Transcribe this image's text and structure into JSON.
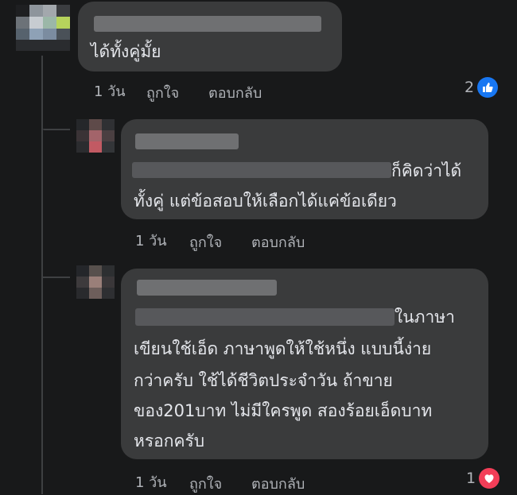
{
  "comments": [
    {
      "author": "",
      "text_lines": [
        "ได้ทั้งคู่มั้ย"
      ],
      "time": "1 วัน",
      "like_label": "ถูกใจ",
      "reply_label": "ตอบกลับ",
      "reaction_count": "2",
      "reaction": "like-icon",
      "reaction_color": "#1877f2"
    },
    {
      "author": "",
      "text_lines": [
        "ก็คิดว่าได้",
        "ทั้งคู่ แต่ข้อสอบให้เลือกได้แค่ข้อเดียว"
      ],
      "time": "1 วัน",
      "like_label": "ถูกใจ",
      "reply_label": "ตอบกลับ"
    },
    {
      "author": "",
      "text_lines": [
        "ในภาษา",
        "เขียนใช้เอ็ด ภาษาพูดให้ใช้หนึ่ง แบบนี้ง่าย",
        "กว่าครับ ใช้ได้ชีวิตประจำวัน ถ้าขาย",
        "ของ201บาท ไม่มีใครพูด สองร้อยเอ็ดบาท",
        "หรอกครับ"
      ],
      "time": "1 วัน",
      "like_label": "ถูกใจ",
      "reply_label": "ตอบกลับ",
      "reaction_count": "1",
      "reaction": "love-icon",
      "reaction_color": "#f33e58"
    }
  ]
}
